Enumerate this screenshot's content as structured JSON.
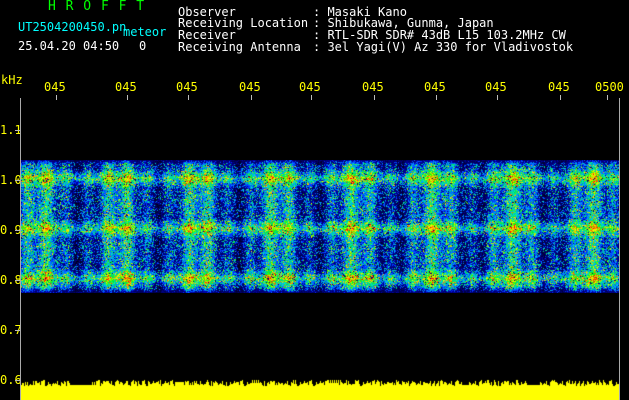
{
  "header": {
    "brand": "H R O F F T",
    "filename": "UT2504200450.pn",
    "meteor_label": "meteor",
    "datetime": "25.04.20 04:50",
    "meteor_count": "0",
    "fields": [
      {
        "label": "Observer",
        "value": ": Masaki Kano"
      },
      {
        "label": "Receiving Location",
        "value": ": Shibukawa, Gunma, Japan"
      },
      {
        "label": "Receiver",
        "value": ": RTL-SDR SDR# 43dB L15 103.2MHz CW"
      },
      {
        "label": "Receiving Antenna",
        "value": ": 3el Yagi(V) Az 330 for Vladivostok"
      }
    ]
  },
  "axes": {
    "unit": "kHz",
    "y_ticks": [
      "1.1",
      "1.0",
      "0.9",
      "0.8",
      "0.7",
      "0.6"
    ],
    "time_labels": [
      "045",
      "045",
      "045",
      "045",
      "045",
      "045",
      "045",
      "045",
      "045",
      "0500"
    ]
  },
  "colors": {
    "background": "#000000",
    "header_text": "#ffffff",
    "brand": "#00ff00",
    "meta": "#00ffff",
    "axis_text": "#ffff00",
    "amplitude": "#ffff00"
  },
  "spectrum": {
    "bands_khz": [
      1.01,
      0.91,
      0.81
    ],
    "low_khz": 0.78,
    "high_khz": 1.03
  }
}
